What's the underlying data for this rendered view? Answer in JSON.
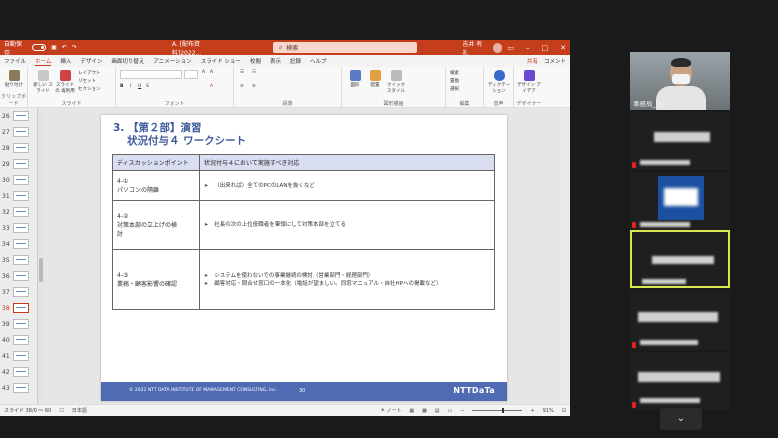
{
  "window": {
    "autosave_label": "自動保存",
    "autosave_state": "オフ",
    "doc_title": "A. [配布資料]2022...",
    "search_placeholder": "検索",
    "user_name": "吉井 有礼"
  },
  "menu": {
    "tabs": [
      "ファイル",
      "ホーム",
      "挿入",
      "デザイン",
      "画面切り替え",
      "アニメーション",
      "スライド ショー",
      "校閲",
      "表示",
      "記録",
      "ヘルプ"
    ],
    "active_index": 1,
    "share": "共有",
    "comment": "コメント"
  },
  "ribbon": {
    "groups": [
      "クリップボード",
      "スライド",
      "フォント",
      "段落",
      "図形描画",
      "編集",
      "音声",
      "デザイナー"
    ],
    "clipboard_paste": "貼り付け",
    "new_slide": "新しい スライド",
    "reuse_slide": "スライドの 再利用",
    "layout": "レイアウト",
    "reset": "リセット",
    "section": "セクション",
    "find": "検索",
    "replace": "置換",
    "select": "選択",
    "dictate": "ディクテーション",
    "designer": "デザイン アイデア",
    "shape": "図形",
    "arrange": "配置",
    "quick_style": "クイック スタイル"
  },
  "thumbnails": {
    "numbers": [
      "26",
      "27",
      "28",
      "29",
      "30",
      "31",
      "32",
      "33",
      "34",
      "35",
      "36",
      "37",
      "38",
      "39",
      "40",
      "41",
      "42",
      "43"
    ],
    "selected": "38"
  },
  "slide": {
    "title_line1": "3. 【第２部】演習",
    "title_line2": "状況付与４ ワークシート",
    "table": {
      "header": [
        "ディスカッションポイント",
        "状況付与４において実施すべき対応"
      ],
      "rows": [
        {
          "point": [
            "4-①",
            "パソコンの隔離"
          ],
          "actions": [
            "（出来れば）全てのPCのLANを抜くなど"
          ]
        },
        {
          "point": [
            "4-②",
            "対策本部の立上げの検",
            "討"
          ],
          "actions": [
            "社長の次の上位役職者を筆頭にして対策本部を立てる"
          ]
        },
        {
          "point": [
            "4-③",
            "業務・顧客影響の確認"
          ],
          "actions": [
            "システムを使わないでの事業継続の検討（営業部門・経理部門）",
            "顧客対応・問合せ窓口の一本化（電話が望ましい。同窓マニュアル・自社HPへの掲載など）"
          ]
        }
      ]
    },
    "footer_copy": "© 2022 NTT DATA INSTITUTE OF MANAGEMENT CONSULTING, Inc.",
    "footer_page": "30",
    "footer_logo": "NTTDaTa"
  },
  "status": {
    "slide_info": "スライド 38/0 ～ 60",
    "language": "日本語",
    "notes": "ノート",
    "zoom": "91%"
  },
  "participants": [
    {
      "name": "事務局_田中"
    },
    {
      "name": ""
    },
    {
      "name": ""
    },
    {
      "name": ""
    },
    {
      "name": ""
    },
    {
      "name": ""
    }
  ],
  "colors": {
    "ppt_accent": "#c43e1c",
    "slide_blue": "#4e6bb4",
    "active_speaker": "#d8e84e"
  }
}
